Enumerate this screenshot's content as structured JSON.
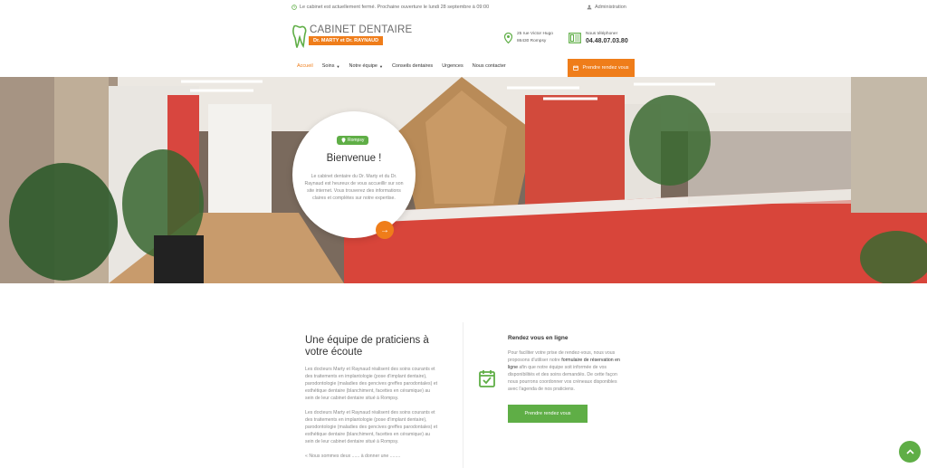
{
  "topbar": {
    "notice": "Le cabinet est actuellement fermé. Prochaine ouverture le lundi 28 septembre à 09:00",
    "admin": "Administration"
  },
  "header": {
    "brand": "CABINET DENTAIRE",
    "doctors": "Dr. MARTY et Dr. RAYNAUD",
    "address_line1": "25 rue Victor Hugo",
    "address_line2": "86430 Rompsy",
    "phone_label": "Nous téléphoner",
    "phone_number": "04.48.07.03.80"
  },
  "nav": {
    "items": [
      {
        "label": "Accueil"
      },
      {
        "label": "Soins"
      },
      {
        "label": "Notre équipe"
      },
      {
        "label": "Conseils dentaires"
      },
      {
        "label": "Urgences"
      },
      {
        "label": "Nous contacter"
      }
    ],
    "cta": "Prendre rendez vous"
  },
  "hero": {
    "pill": "Rompsy",
    "title": "Bienvenue !",
    "text": "Le cabinet dentaire du Dr. Marty et du Dr. Raynaud est heureux de vous accueillir sur son site internet. Vous trouverez des informations claires et complètes sur notre expertise."
  },
  "team": {
    "title": "Une équipe de praticiens à votre écoute",
    "p1": "Les docteurs Marty et Raynaud réalisent des soins courants et des traitements en implantologie (pose d'implant dentaire), parodontologie (maladies des gencives greffes parodontales) et esthétique dentaire (blanchiment, facettes en céramique) au sein de leur cabinet dentaire situé à Rompsy.",
    "p2": "Les docteurs Marty et Raynaud réalisent des soins courants et des traitements en implantologie (pose d'implant dentaire), parodontologie (maladies des gencives greffes parodontales) et esthétique dentaire (blanchiment, facettes en céramique) au sein de leur cabinet dentaire situé à Rompsy.",
    "p3": "« Nous sommes deux ...... à donner une ........"
  },
  "rdv": {
    "title": "Rendez vous en ligne",
    "text_before": "Pour faciliter votre prise de rendez-vous, nous vous proposons d'utiliser notre ",
    "link": "formulaire de réservation en ligne",
    "text_after": " afin que notre équipe soit informée de vos disponibilités et des soins demandés. De cette façon nous pourrons coordonner vos créneaux disponibles avec l'agenda de nos praticiens.",
    "button": "Prendre rendez vous"
  },
  "colors": {
    "accent": "#ef7d1a",
    "green": "#5fae46"
  }
}
